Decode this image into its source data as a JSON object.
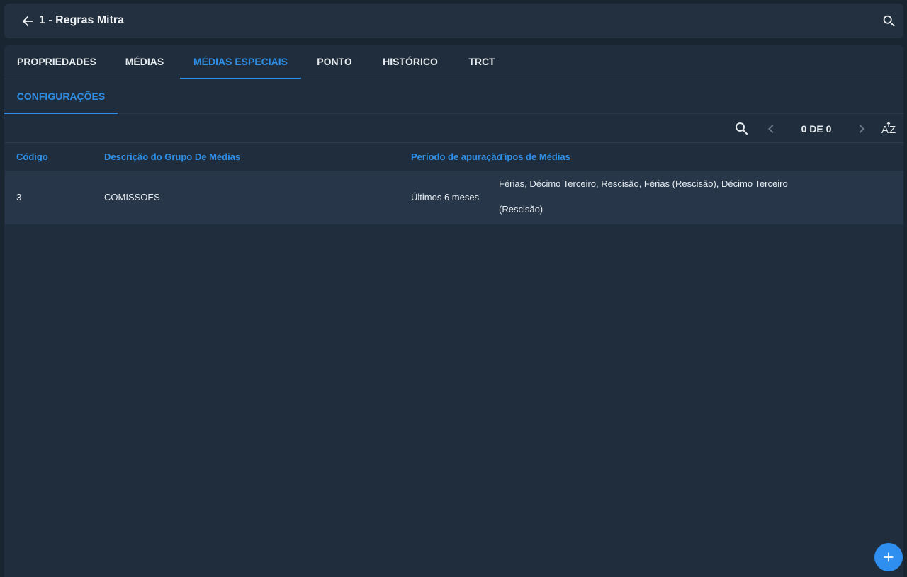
{
  "header": {
    "title": "1 - Regras Mitra",
    "back_icon": "arrow-left-icon",
    "search_icon": "search-icon"
  },
  "tabs": [
    {
      "label": "PROPRIEDADES",
      "active": false
    },
    {
      "label": "MÉDIAS",
      "active": false
    },
    {
      "label": "MÉDIAS ESPECIAIS",
      "active": true
    },
    {
      "label": "PONTO",
      "active": false
    },
    {
      "label": "HISTÓRICO",
      "active": false
    },
    {
      "label": "TRCT",
      "active": false
    }
  ],
  "subtabs": [
    {
      "label": "CONFIGURAÇÕES",
      "active": true
    }
  ],
  "toolbar": {
    "pager_text": "0 DE 0",
    "icons": [
      "search-icon",
      "chevron-left-icon",
      "chevron-right-icon",
      "sort-az-icon"
    ]
  },
  "table": {
    "columns": [
      "Código",
      "Descrição do Grupo De Médias",
      "Período de apuração",
      "Tipos de Médias"
    ],
    "rows": [
      {
        "codigo": "3",
        "descricao": "COMISSOES",
        "periodo": "Últimos 6 meses",
        "tipos": "Férias, Décimo Terceiro, Rescisão, Férias (Rescisão), Décimo Terceiro (Rescisão)"
      }
    ]
  },
  "fab": {
    "icon": "plus-icon"
  },
  "colors": {
    "accent": "#2f8fe6",
    "background": "#1a2532",
    "surface": "#202d3c",
    "row_highlight": "#273749"
  }
}
